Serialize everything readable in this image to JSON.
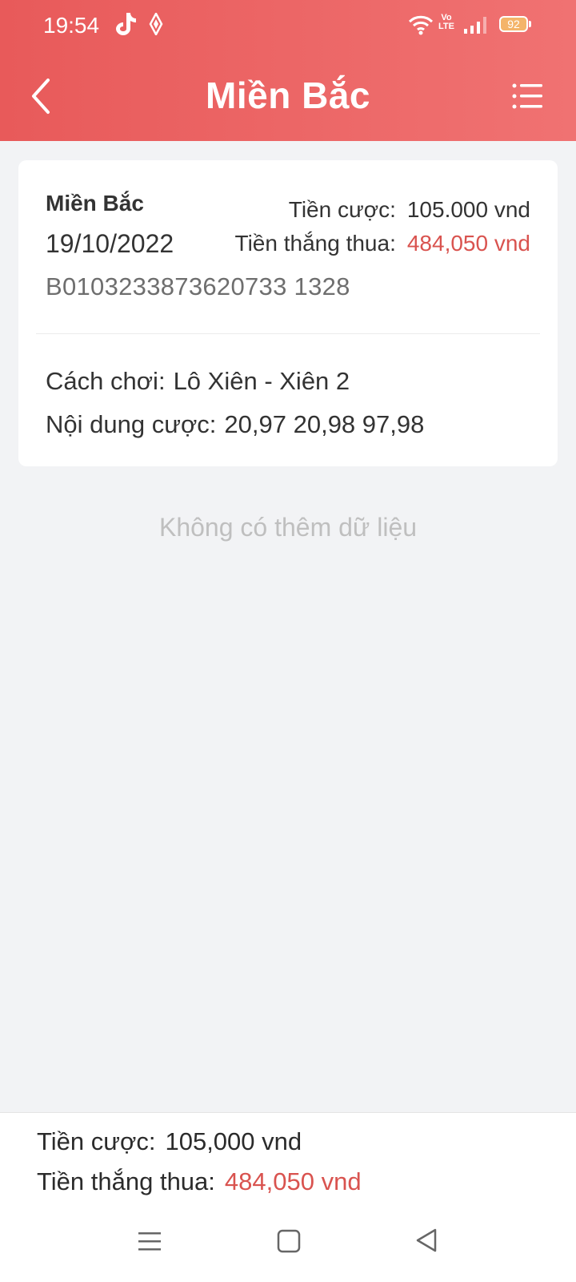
{
  "status_bar": {
    "time": "19:54",
    "volte_top": "Vo",
    "volte_bottom": "LTE",
    "battery": "92"
  },
  "header": {
    "title": "Miền Bắc"
  },
  "ticket": {
    "region": "Miền Bắc",
    "date": "19/10/2022",
    "id": "B0103233873620733 1328",
    "stake_label": "Tiền cược:",
    "stake_value": "105.000 vnd",
    "result_label": "Tiền thắng thua:",
    "result_value": "484,050 vnd",
    "play_label": "Cách chơi:",
    "play_value": "Lô Xiên - Xiên 2",
    "content_label": "Nội dung cược:",
    "content_value": "20,97 20,98 97,98"
  },
  "list": {
    "no_more": "Không có thêm dữ liệu"
  },
  "summary": {
    "stake_label": "Tiền cược:",
    "stake_value": "105,000 vnd",
    "result_label": "Tiền thắng thua:",
    "result_value": "484,050 vnd"
  },
  "colors": {
    "header_start": "#e85a5a",
    "header_end": "#f07272",
    "negative_red": "#d9534f",
    "background": "#f2f3f5"
  },
  "icons": [
    "tiktok-icon",
    "app-icon",
    "wifi-icon",
    "signal-icon",
    "battery-icon",
    "back-icon",
    "menu-icon",
    "nav-menu-icon",
    "nav-home-icon",
    "nav-back-icon"
  ]
}
